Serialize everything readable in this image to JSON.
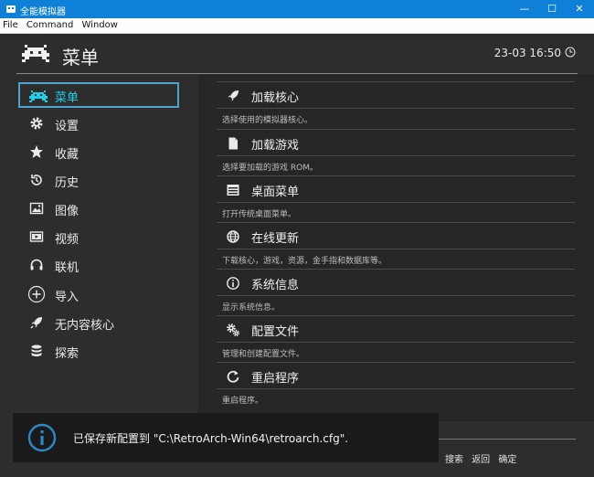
{
  "window": {
    "title": "全能模拟器",
    "minimize": "—",
    "maximize": "☐",
    "close": "✕"
  },
  "menubar": {
    "items": [
      "File",
      "Command",
      "Window"
    ]
  },
  "header": {
    "title": "菜单",
    "clock": "23-03 16:50"
  },
  "sidebar": {
    "items": [
      {
        "label": "菜单",
        "icon": "invader-icon",
        "active": true
      },
      {
        "label": "设置",
        "icon": "gear-icon"
      },
      {
        "label": "收藏",
        "icon": "star-icon"
      },
      {
        "label": "历史",
        "icon": "history-icon"
      },
      {
        "label": "图像",
        "icon": "image-icon"
      },
      {
        "label": "视频",
        "icon": "video-icon"
      },
      {
        "label": "联机",
        "icon": "headset-icon"
      },
      {
        "label": "导入",
        "icon": "plus-icon"
      },
      {
        "label": "无内容核心",
        "icon": "rocket-icon"
      },
      {
        "label": "探索",
        "icon": "database-icon"
      }
    ]
  },
  "main": {
    "entries": [
      {
        "title": "加载核心",
        "desc": "选择使用的模拟器核心。",
        "icon": "rocket-icon"
      },
      {
        "title": "加载游戏",
        "desc": "选择要加载的游戏 ROM。",
        "icon": "file-icon"
      },
      {
        "title": "桌面菜单",
        "desc": "打开传统桌面菜单。",
        "icon": "menu-window-icon"
      },
      {
        "title": "在线更新",
        "desc": "下载核心，游戏，资源，金手指和数据库等。",
        "icon": "globe-icon"
      },
      {
        "title": "系统信息",
        "desc": "显示系统信息。",
        "icon": "info-icon"
      },
      {
        "title": "配置文件",
        "desc": "管理和创建配置文件。",
        "icon": "gears-icon"
      },
      {
        "title": "重启程序",
        "desc": "重启程序。",
        "icon": "restart-icon"
      }
    ]
  },
  "toast": {
    "text": "已保存新配置到 \"C:\\RetroArch-Win64\\retroarch.cfg\"."
  },
  "footer": {
    "search": "搜索",
    "back": "返回",
    "ok": "确定"
  },
  "colors": {
    "titlebar": "#0f80d8",
    "accent": "#1fcfe8",
    "active_border": "#4fa3d1"
  }
}
